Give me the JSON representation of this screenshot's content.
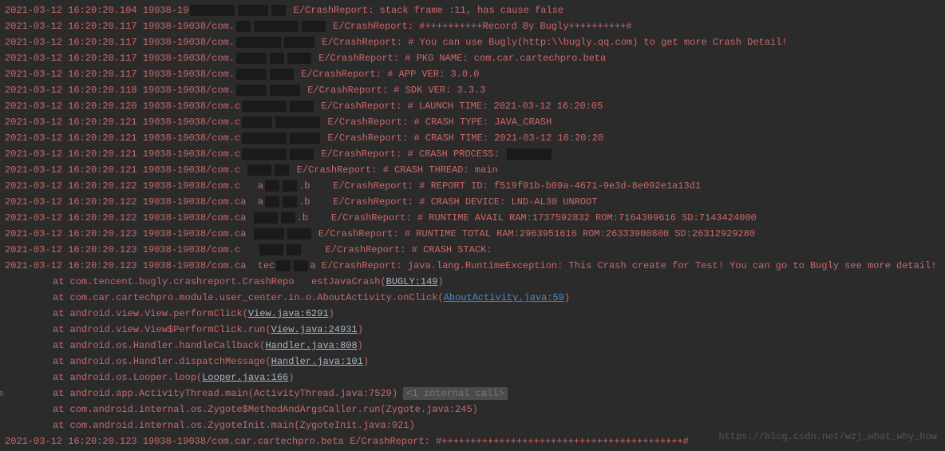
{
  "logs": [
    {
      "lead": "2021-03-12 16:20:20.104 19038-19",
      "mask": [
        "ob-b",
        "ob-a",
        "ob-c"
      ],
      "msg": " E/CrashReport: stack frame :11, has cause false"
    },
    {
      "lead": "2021-03-12 16:20:20.117 19038-19038/com.",
      "mask": [
        "ob-c",
        "ob-b",
        "ob-d"
      ],
      "msg": " E/CrashReport: #++++++++++Record By Bugly++++++++++#"
    },
    {
      "lead": "2021-03-12 16:20:20.117 19038-19038/com.",
      "mask": [
        "ob-b",
        "ob-a"
      ],
      "msg": " E/CrashReport: # You can use Bugly(http:\\\\bugly.qq.com) to get more Crash Detail!"
    },
    {
      "lead": "2021-03-12 16:20:20.117 19038-19038/com.",
      "mask": [
        "ob-a",
        "ob-c",
        "ob-d"
      ],
      "msg": " E/CrashReport: # PKG NAME: com.car.cartechpro.beta"
    },
    {
      "lead": "2021-03-12 16:20:20.117 19038-19038/com.",
      "mask": [
        "ob-a",
        "ob-d"
      ],
      "msg": " E/CrashReport: # APP VER: 3.0.0"
    },
    {
      "lead": "2021-03-12 16:20:20.118 19038-19038/com.",
      "mask": [
        "ob-a",
        "ob-a"
      ],
      "msg": " E/CrashReport: # SDK VER: 3.3.3"
    },
    {
      "lead": "2021-03-12 16:20:20.120 19038-19038/com.c",
      "mask": [
        "ob-b",
        "ob-d"
      ],
      "msg": " E/CrashReport: # LAUNCH TIME: 2021-03-12 16:20:05"
    },
    {
      "lead": "2021-03-12 16:20:20.121 19038-19038/com.c",
      "mask": [
        "ob-a",
        "ob-b"
      ],
      "msg": " E/CrashReport: # CRASH TYPE: JAVA_CRASH"
    },
    {
      "lead": "2021-03-12 16:20:20.121 19038-19038/com.c",
      "mask": [
        "ob-b",
        "ob-a"
      ],
      "msg": " E/CrashReport: # CRASH TIME: 2021-03-12 16:20:20"
    },
    {
      "lead": "2021-03-12 16:20:20.121 19038-19038/com.c",
      "mask": [
        "ob-b",
        "ob-d"
      ],
      "msg": " E/CrashReport: # CRASH PROCESS: "
    },
    {
      "lead": "2021-03-12 16:20:20.121 19038-19038/com.c ",
      "mask": [
        "ob-d",
        "ob-c"
      ],
      "msg": " E/CrashReport: # CRASH THREAD: main"
    },
    {
      "lead": "2021-03-12 16:20:20.122 19038-19038/com.c   a",
      "mask": [
        "ob-c",
        "ob-c"
      ],
      "msg": ".b    E/CrashReport: # REPORT ID: f519f91b-b09a-4671-9e3d-8e092e1a13d1"
    },
    {
      "lead": "2021-03-12 16:20:20.122 19038-19038/com.ca  a",
      "mask": [
        "ob-c",
        "ob-c"
      ],
      "msg": ".b    E/CrashReport: # CRASH DEVICE: LND-AL30 UNROOT"
    },
    {
      "lead": "2021-03-12 16:20:20.122 19038-19038/com.ca ",
      "mask": [
        "ob-d",
        "ob-c"
      ],
      "msg": ".b    E/CrashReport: # RUNTIME AVAIL RAM:1737592832 ROM:7164399616 SD:7143424000"
    },
    {
      "lead": "2021-03-12 16:20:20.123 19038-19038/com.ca ",
      "mask": [
        "ob-a",
        "ob-d"
      ],
      "msg": " E/CrashReport: # RUNTIME TOTAL RAM:2963951616 ROM:26333900800 SD:26312929280"
    },
    {
      "lead": "2021-03-12 16:20:20.123 19038-19038/com.c   ",
      "mask": [
        "ob-d",
        "ob-c"
      ],
      "msg": "    E/CrashReport: # CRASH STACK:"
    },
    {
      "lead": "2021-03-12 16:20:20.123 19038-19038/com.ca  tec",
      "mask": [
        "ob-c",
        "ob-c"
      ],
      "msg": "a E/CrashReport: java.lang.RuntimeException: This Crash create for Test! You can go to Bugly see more detail!"
    }
  ],
  "stack": [
    {
      "pre": "at com.tencent.bugly.crashreport.CrashRepo   estJavaCrash(",
      "link": "BUGLY:149",
      "linkClass": "paren",
      "suf": ")"
    },
    {
      "pre": "at com.car.cartechpro.module.user_center.in.o.AboutActivity.onClick(",
      "link": "AboutActivity.java:59",
      "linkClass": "link",
      "suf": ")"
    },
    {
      "pre": "at android.view.View.performClick(",
      "link": "View.java:6291",
      "linkClass": "paren",
      "suf": ")"
    },
    {
      "pre": "at android.view.View$PerformClick.run(",
      "link": "View.java:24931",
      "linkClass": "paren",
      "suf": ")"
    },
    {
      "pre": "at android.os.Handler.handleCallback(",
      "link": "Handler.java:808",
      "linkClass": "paren",
      "suf": ")"
    },
    {
      "pre": "at android.os.Handler.dispatchMessage(",
      "link": "Handler.java:101",
      "linkClass": "paren",
      "suf": ")"
    },
    {
      "pre": "at android.os.Looper.loop(",
      "link": "Looper.java:166",
      "linkClass": "paren",
      "suf": ")"
    },
    {
      "pre": "at android.app.ActivityThread.main(ActivityThread.java:7529) ",
      "link": "",
      "linkClass": "",
      "suf": "",
      "internal": "<1 internal call>"
    },
    {
      "pre": "at com.android.internal.os.Zygote$MethodAndArgsCaller.run(Zygote.java:245)",
      "link": "",
      "linkClass": "",
      "suf": ""
    },
    {
      "pre": "at com.android.internal.os.ZygoteInit.main(ZygoteInit.java:921)",
      "link": "",
      "linkClass": "",
      "suf": ""
    }
  ],
  "finalLine": "2021-03-12 16:20:20.123 19038-19038/com.car.cartechpro.beta E/CrashReport: #++++++++++++++++++++++++++++++++++++++++++#",
  "watermark": "https://blog.csdn.net/wzj_what_why_how",
  "gutterIcon": "⊞"
}
